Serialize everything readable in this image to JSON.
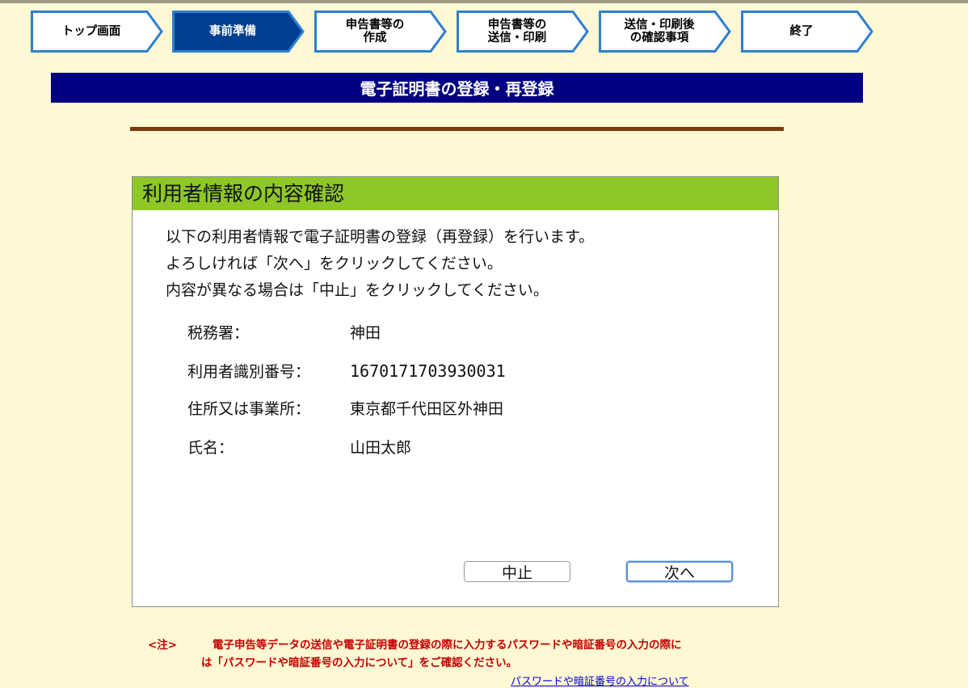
{
  "steps": [
    {
      "label": "トップ画面",
      "active": false
    },
    {
      "label": "事前準備",
      "active": true
    },
    {
      "label": "申告書等の\n作成",
      "active": false
    },
    {
      "label": "申告書等の\n送信・印刷",
      "active": false
    },
    {
      "label": "送信・印刷後\nの確認事項",
      "active": false
    },
    {
      "label": "終了",
      "active": false
    }
  ],
  "colors": {
    "page_bg": "#fff8d4",
    "step_fill": "#ffffff",
    "step_active_fill": "#003f8f",
    "step_border": "#2d7fd2",
    "title_bar": "#000080",
    "panel_header": "#8ec727",
    "rule": "#7a3a10",
    "note": "#c40000"
  },
  "page_title": "電子証明書の登録・再登録",
  "panel": {
    "header": "利用者情報の内容確認",
    "intro": [
      "以下の利用者情報で電子証明書の登録（再登録）を行います。",
      "よろしければ「次へ」をクリックしてください。",
      "内容が異なる場合は「中止」をクリックしてください。"
    ],
    "fields": {
      "tax_office": {
        "label": "税務署：",
        "value": "神田"
      },
      "user_id": {
        "label": "利用者識別番号：",
        "value": "1670171703930031"
      },
      "address": {
        "label": "住所又は事業所：",
        "value": "東京都千代田区外神田"
      },
      "name": {
        "label": "氏名：",
        "value": "山田太郎"
      }
    },
    "buttons": {
      "cancel": "中止",
      "next": "次へ"
    }
  },
  "note": {
    "tag": "<注>",
    "line1": "電子申告等データの送信や電子証明書の登録の際に入力するパスワードや暗証番号の入力の際に",
    "line2": "は「パスワードや暗証番号の入力について」をご確認ください。",
    "link": "パスワードや暗証番号の入力について"
  }
}
